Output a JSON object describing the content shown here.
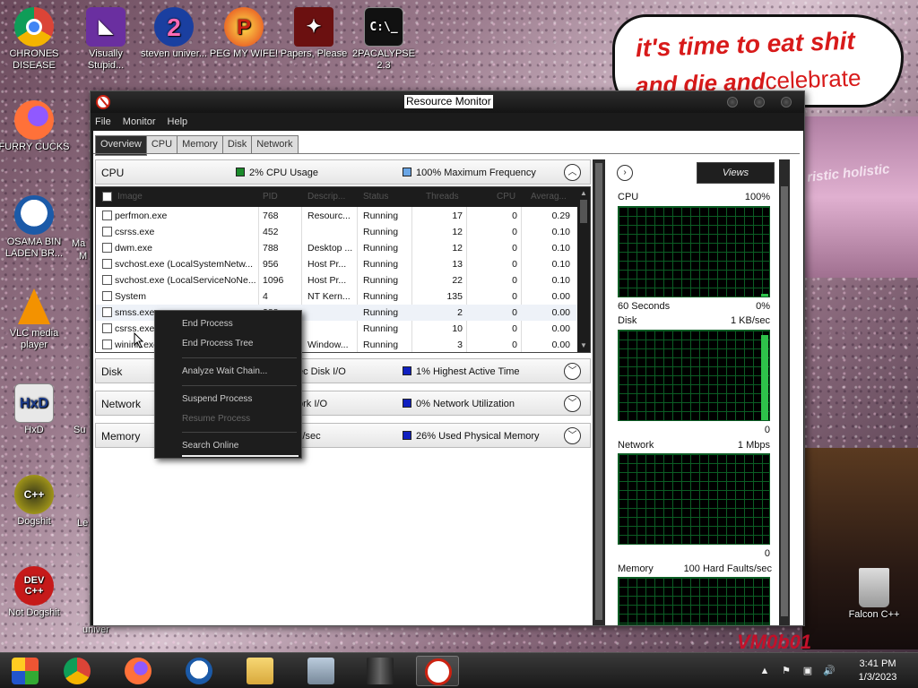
{
  "desktop": {
    "icons": [
      {
        "label": "CHRONES DISEASE",
        "icon": "chrome-icon"
      },
      {
        "label": "Visually Stupid...",
        "icon": "visual-studio-icon"
      },
      {
        "label": "steven univer...",
        "icon": "steven-universe-icon"
      },
      {
        "label": "PEG MY WIFE!",
        "icon": "peggle-icon"
      },
      {
        "label": "Papers, Please",
        "icon": "papers-please-icon"
      },
      {
        "label": "2PACALYPSE 2.3",
        "icon": "cmd-icon"
      },
      {
        "label": "FURRY CUCKS",
        "icon": "firefox-icon"
      },
      {
        "label": "OSAMA BIN LADEN BR...",
        "icon": "obama-logo-icon"
      },
      {
        "label": "VLC media player",
        "icon": "vlc-icon"
      },
      {
        "label": "HxD",
        "icon": "hxd-icon"
      },
      {
        "label": "Dogshit",
        "icon": "dogshit-icon"
      },
      {
        "label": "Not Dogshit",
        "icon": "devcpp-icon"
      },
      {
        "label": "Falcon C++",
        "icon": "recycle-bin-icon"
      }
    ],
    "partial_labels": [
      "Ma",
      "M",
      "Su",
      "Le",
      "univer"
    ],
    "glyph_text": {
      "cmd": "C:\\_",
      "hxd": "HxD",
      "devcpp": "DEV C++",
      "dogshit": "C++"
    },
    "bubble": {
      "line1": "it's time to eat shit",
      "line2_bold": "and die and",
      "line2_plain": "celebrate"
    },
    "wallpaper_text": {
      "stage": "ristic holistic",
      "vm": "VM0b01"
    }
  },
  "window": {
    "title": "Resource Monitor",
    "menu": [
      "File",
      "Monitor",
      "Help"
    ],
    "tabs": [
      "Overview",
      "CPU",
      "Memory",
      "Disk",
      "Network"
    ],
    "active_tab": "Overview"
  },
  "cpu_section": {
    "name": "CPU",
    "legend1": {
      "text": "2% CPU Usage",
      "color": "#1a8a2a"
    },
    "legend2": {
      "text": "100% Maximum Frequency",
      "color": "#6aa6e6"
    },
    "columns": [
      "Image",
      "PID",
      "Descrip...",
      "Status",
      "Threads",
      "CPU",
      "Averag..."
    ],
    "rows": [
      {
        "image": "perfmon.exe",
        "pid": "768",
        "desc": "Resourc...",
        "status": "Running",
        "threads": "17",
        "cpu": "0",
        "avg": "0.29"
      },
      {
        "image": "csrss.exe",
        "pid": "452",
        "desc": "",
        "status": "Running",
        "threads": "12",
        "cpu": "0",
        "avg": "0.10"
      },
      {
        "image": "dwm.exe",
        "pid": "788",
        "desc": "Desktop ...",
        "status": "Running",
        "threads": "12",
        "cpu": "0",
        "avg": "0.10"
      },
      {
        "image": "svchost.exe (LocalSystemNetw...",
        "pid": "956",
        "desc": "Host Pr...",
        "status": "Running",
        "threads": "13",
        "cpu": "0",
        "avg": "0.10"
      },
      {
        "image": "svchost.exe (LocalServiceNoNe...",
        "pid": "1096",
        "desc": "Host Pr...",
        "status": "Running",
        "threads": "22",
        "cpu": "0",
        "avg": "0.10"
      },
      {
        "image": "System",
        "pid": "4",
        "desc": "NT Kern...",
        "status": "Running",
        "threads": "135",
        "cpu": "0",
        "avg": "0.00"
      },
      {
        "image": "smss.exe",
        "pid": "288",
        "desc": "",
        "status": "Running",
        "threads": "2",
        "cpu": "0",
        "avg": "0.00"
      },
      {
        "image": "csrss.exe",
        "pid": "",
        "desc": "",
        "status": "Running",
        "threads": "10",
        "cpu": "0",
        "avg": "0.00"
      },
      {
        "image": "wininit.exe",
        "pid": "",
        "desc": "Window...",
        "status": "Running",
        "threads": "3",
        "cpu": "0",
        "avg": "0.00"
      }
    ]
  },
  "disk_section": {
    "name": "Disk",
    "legend1": "ec Disk I/O",
    "legend2": {
      "text": "1% Highest Active Time",
      "color": "#1020c0"
    }
  },
  "network_section": {
    "name": "Network",
    "legend1": "ork I/O",
    "legend2": {
      "text": "0% Network Utilization",
      "color": "#1020c0"
    }
  },
  "memory_section": {
    "name": "Memory",
    "legend1": "s/sec",
    "legend2": {
      "text": "26% Used Physical Memory",
      "color": "#1020c0"
    }
  },
  "context_menu": {
    "items": [
      "End Process",
      "End Process Tree",
      "Analyze Wait Chain...",
      "Suspend Process",
      "Resume Process",
      "Search Online"
    ],
    "disabled": [
      "Resume Process"
    ]
  },
  "graphs": {
    "views_label": "Views",
    "cpu": {
      "title": "CPU",
      "max": "100%",
      "footer_left": "60 Seconds",
      "footer_right": "0%",
      "level": 0.03
    },
    "disk": {
      "title": "Disk",
      "max": "1 KB/sec",
      "footer_right": "0",
      "level": 0.95
    },
    "network": {
      "title": "Network",
      "max": "1 Mbps",
      "footer_right": "0",
      "level": 0.0
    },
    "memory": {
      "title": "Memory",
      "max": "100 Hard Faults/sec"
    }
  },
  "taskbar": {
    "buttons": [
      "start-icon",
      "chrome-icon",
      "firefox-icon",
      "obama-logo-icon",
      "file-explorer-icon",
      "control-panel-icon",
      "photo-icon",
      "resource-monitor-icon"
    ],
    "active": "resource-monitor-icon",
    "time": "3:41 PM",
    "date": "1/3/2023"
  }
}
